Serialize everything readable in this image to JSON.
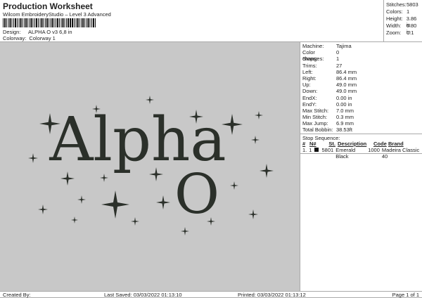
{
  "header": {
    "title": "Production Worksheet",
    "subtitle": "Wilcom EmbroideryStudio – Level 3 Advanced",
    "design_label": "Design:",
    "design": "ALPHA O v3 6,8 in",
    "colorway_label": "Colorway:",
    "colorway": "Colorway 1"
  },
  "stats": [
    {
      "k": "Stitches:",
      "v": "5803"
    },
    {
      "k": "Colors:",
      "v": "1"
    },
    {
      "k": "Height:",
      "v": "3.86 in"
    },
    {
      "k": "Width:",
      "v": "6.80 in"
    },
    {
      "k": "Zoom:",
      "v": "1:1"
    }
  ],
  "details": [
    {
      "k": "Machine:",
      "v": "Tajima"
    },
    {
      "k": "Color changes:",
      "v": "0"
    },
    {
      "k": "Stops:",
      "v": "1"
    },
    {
      "k": "Trims:",
      "v": "27"
    },
    {
      "k": "Left:",
      "v": "86.4 mm"
    },
    {
      "k": "Right:",
      "v": "86.4 mm"
    },
    {
      "k": "Up:",
      "v": "49.0 mm"
    },
    {
      "k": "Down:",
      "v": "49.0 mm"
    },
    {
      "k": "EndX:",
      "v": "0.00 in"
    },
    {
      "k": "EndY:",
      "v": "0.00 in"
    },
    {
      "k": "Max Stitch:",
      "v": "7.0 mm"
    },
    {
      "k": "Min Stitch:",
      "v": "0.3 mm"
    },
    {
      "k": "Max Jump:",
      "v": "6.9 mm"
    },
    {
      "k": "Total Bobbin:",
      "v": "38.53ft"
    }
  ],
  "stop_sequence": {
    "label": "Stop Sequence:",
    "headers": [
      "#",
      "N#",
      "St.",
      "Description",
      "Code",
      "Brand"
    ],
    "rows": [
      [
        "1.",
        "1",
        "5801",
        "Emerald Black",
        "1000",
        "Madeira Classic 40"
      ]
    ],
    "swatch_color": "#111111"
  },
  "design_art": {
    "line1": "Alpha",
    "line2": "O",
    "thread_color": "#2b302a",
    "background": "#c8c8c8"
  },
  "footer": {
    "created": "Created By:",
    "saved": "Last Saved: 03/03/2022 01:13:10",
    "printed": "Printed: 03/03/2022 01:13:12",
    "page": "Page 1 of 1"
  }
}
